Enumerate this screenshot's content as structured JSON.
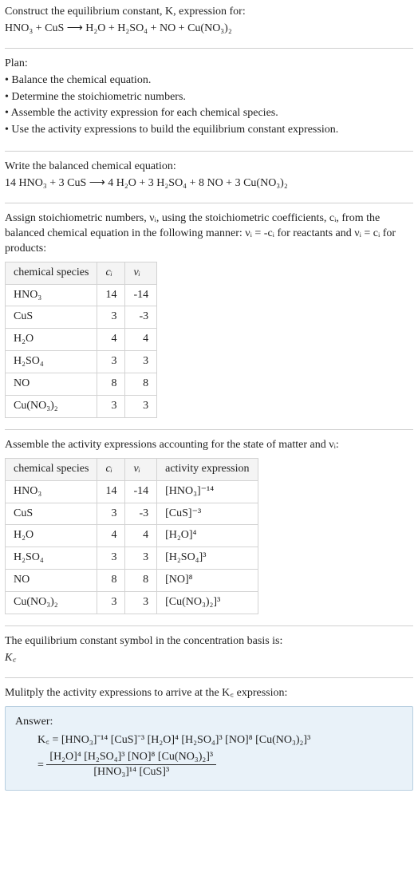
{
  "s1": {
    "line1": "Construct the equilibrium constant, K, expression for:",
    "eq": "HNO₃ + CuS ⟶ H₂O + H₂SO₄ + NO + Cu(NO₃)₂"
  },
  "s2": {
    "h": "Plan:",
    "b1": "• Balance the chemical equation.",
    "b2": "• Determine the stoichiometric numbers.",
    "b3": "• Assemble the activity expression for each chemical species.",
    "b4": "• Use the activity expressions to build the equilibrium constant expression."
  },
  "s3": {
    "h": "Write the balanced chemical equation:",
    "eq": "14 HNO₃ + 3 CuS ⟶ 4 H₂O + 3 H₂SO₄ + 8 NO + 3 Cu(NO₃)₂"
  },
  "s4": {
    "intro": "Assign stoichiometric numbers, νᵢ, using the stoichiometric coefficients, cᵢ, from the balanced chemical equation in the following manner: νᵢ = -cᵢ for reactants and νᵢ = cᵢ for products:",
    "headers": {
      "h1": "chemical species",
      "h2": "cᵢ",
      "h3": "νᵢ"
    },
    "rows": [
      {
        "sp": "HNO₃",
        "c": "14",
        "v": "-14"
      },
      {
        "sp": "CuS",
        "c": "3",
        "v": "-3"
      },
      {
        "sp": "H₂O",
        "c": "4",
        "v": "4"
      },
      {
        "sp": "H₂SO₄",
        "c": "3",
        "v": "3"
      },
      {
        "sp": "NO",
        "c": "8",
        "v": "8"
      },
      {
        "sp": "Cu(NO₃)₂",
        "c": "3",
        "v": "3"
      }
    ]
  },
  "s5": {
    "intro": "Assemble the activity expressions accounting for the state of matter and νᵢ:",
    "headers": {
      "h1": "chemical species",
      "h2": "cᵢ",
      "h3": "νᵢ",
      "h4": "activity expression"
    },
    "rows": [
      {
        "sp": "HNO₃",
        "c": "14",
        "v": "-14",
        "a": "[HNO₃]⁻¹⁴"
      },
      {
        "sp": "CuS",
        "c": "3",
        "v": "-3",
        "a": "[CuS]⁻³"
      },
      {
        "sp": "H₂O",
        "c": "4",
        "v": "4",
        "a": "[H₂O]⁴"
      },
      {
        "sp": "H₂SO₄",
        "c": "3",
        "v": "3",
        "a": "[H₂SO₄]³"
      },
      {
        "sp": "NO",
        "c": "8",
        "v": "8",
        "a": "[NO]⁸"
      },
      {
        "sp": "Cu(NO₃)₂",
        "c": "3",
        "v": "3",
        "a": "[Cu(NO₃)₂]³"
      }
    ]
  },
  "s6": {
    "line1": "The equilibrium constant symbol in the concentration basis is:",
    "sym": "K꜀"
  },
  "s7": {
    "line1": "Mulitply the activity expressions to arrive at the K꜀ expression:",
    "ansLabel": "Answer:",
    "expr1": "K꜀ = [HNO₃]⁻¹⁴ [CuS]⁻³ [H₂O]⁴ [H₂SO₄]³ [NO]⁸ [Cu(NO₃)₂]³",
    "eqPrefix": "= ",
    "fracNum": "[H₂O]⁴ [H₂SO₄]³ [NO]⁸ [Cu(NO₃)₂]³",
    "fracDen": "[HNO₃]¹⁴ [CuS]³"
  }
}
